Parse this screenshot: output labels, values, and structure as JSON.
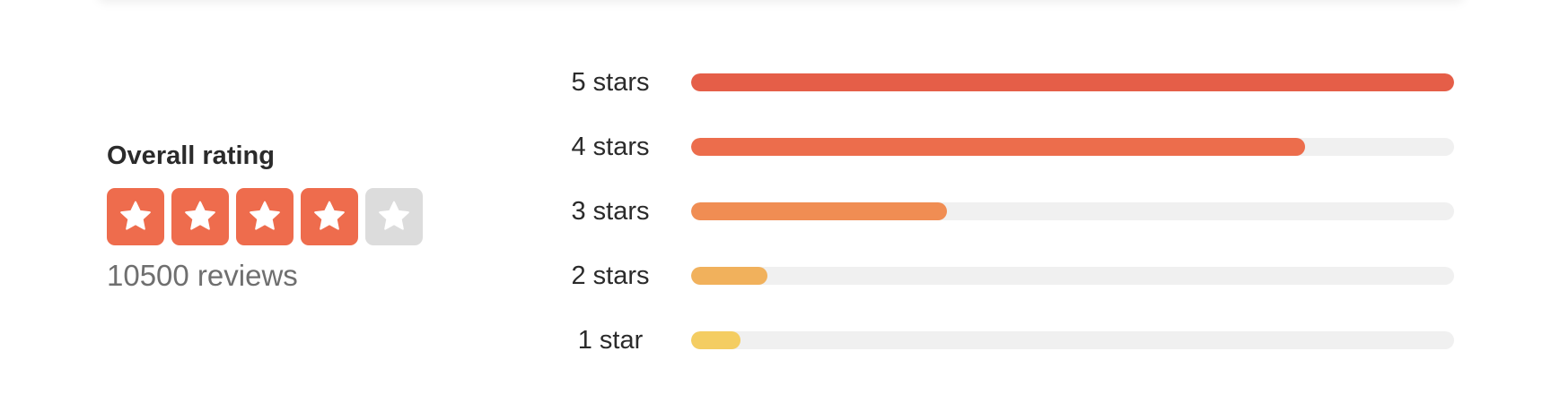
{
  "summary": {
    "title": "Overall rating",
    "rating": 4,
    "max_rating": 5,
    "reviews": "10500 reviews",
    "active_color": "#ee6c4d",
    "inactive_color": "#dcdcdc",
    "star_icon": "star-icon"
  },
  "breakdown": [
    {
      "label": "5 stars",
      "fraction": 1.0,
      "color": "#e55e48"
    },
    {
      "label": "4 stars",
      "fraction": 0.805,
      "color": "#ec6d4c"
    },
    {
      "label": "3 stars",
      "fraction": 0.335,
      "color": "#f08d53"
    },
    {
      "label": "2 stars",
      "fraction": 0.1,
      "color": "#f1b15c"
    },
    {
      "label": "1 star",
      "fraction": 0.065,
      "color": "#f4cd62"
    }
  ]
}
